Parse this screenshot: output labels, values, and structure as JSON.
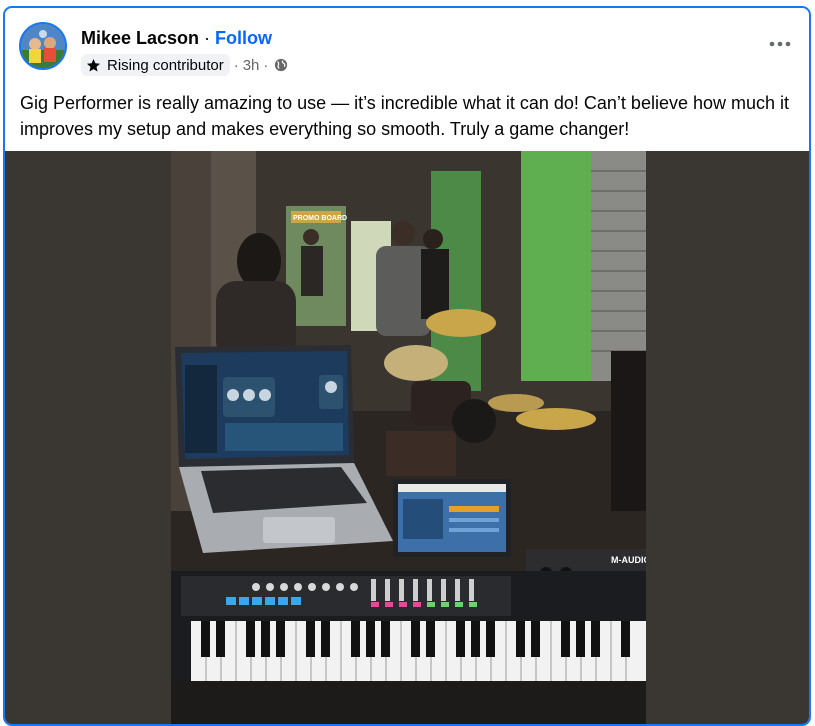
{
  "author": {
    "name": "Mikee Lacson",
    "follow_label": "Follow",
    "badge_label": "Rising contributor",
    "time": "3h",
    "separator": "·",
    "avatar_icon": "avatar-photo",
    "badge_icon": "star-icon",
    "audience_icon": "globe-icon"
  },
  "post": {
    "text": "Gig Performer is really amazing to use — it’s incredible what it can do! Can’t believe how much it improves my setup and makes everything so smooth. Truly a game changer!",
    "more_icon": "more-options-icon"
  },
  "photo": {
    "sign_text": "PROMO BOARD",
    "keyboard_brand": "M-AUDIO"
  },
  "colors": {
    "accent": "#1877f2",
    "follow": "#0866ff",
    "text": "#050505",
    "secondary": "#65676b",
    "media_bg": "#3a3632"
  }
}
